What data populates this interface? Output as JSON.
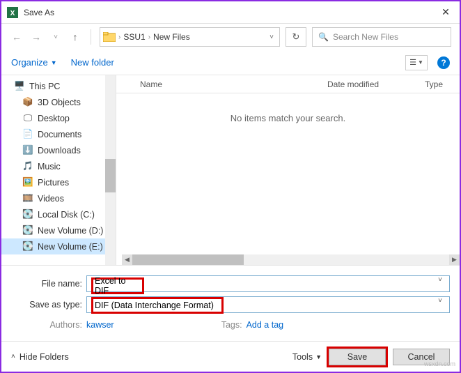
{
  "titlebar": {
    "title": "Save As"
  },
  "nav": {
    "crumbs": [
      "SSU1",
      "New Files"
    ],
    "search_placeholder": "Search New Files"
  },
  "toolbar": {
    "organize": "Organize",
    "new_folder": "New folder"
  },
  "tree": {
    "items": [
      {
        "label": "This PC",
        "icon": "pc"
      },
      {
        "label": "3D Objects",
        "icon": "3d"
      },
      {
        "label": "Desktop",
        "icon": "desktop"
      },
      {
        "label": "Documents",
        "icon": "docs"
      },
      {
        "label": "Downloads",
        "icon": "down"
      },
      {
        "label": "Music",
        "icon": "music"
      },
      {
        "label": "Pictures",
        "icon": "pics"
      },
      {
        "label": "Videos",
        "icon": "vids"
      },
      {
        "label": "Local Disk (C:)",
        "icon": "disk"
      },
      {
        "label": "New Volume (D:)",
        "icon": "disk"
      },
      {
        "label": "New Volume (E:)",
        "icon": "disk",
        "selected": true
      }
    ]
  },
  "content": {
    "columns": {
      "name": "Name",
      "date": "Date modified",
      "type": "Type"
    },
    "empty": "No items match your search."
  },
  "form": {
    "filename_label": "File name:",
    "filename_value": "Excel to DIF",
    "filetype_label": "Save as type:",
    "filetype_value": "DIF (Data Interchange Format)",
    "authors_label": "Authors:",
    "authors_value": "kawser",
    "tags_label": "Tags:",
    "tags_value": "Add a tag"
  },
  "footer": {
    "hide_folders": "Hide Folders",
    "tools": "Tools",
    "save": "Save",
    "cancel": "Cancel"
  },
  "watermark": "wsxdn.com"
}
